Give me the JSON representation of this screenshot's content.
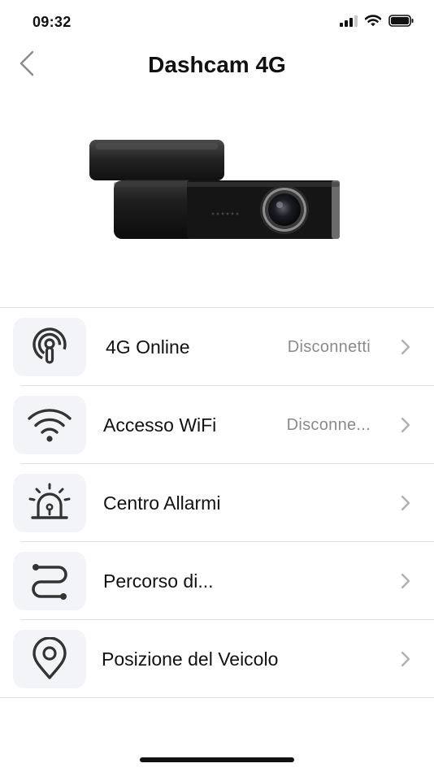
{
  "status_bar": {
    "time": "09:32",
    "icons": [
      "signal-icon",
      "wifi-icon",
      "battery-icon"
    ]
  },
  "nav": {
    "title": "Dashcam 4G",
    "back_icon": "chevron-left-icon"
  },
  "device": {
    "image": "dashcam-device-image"
  },
  "menu": {
    "items": [
      {
        "label": "4G Online",
        "status": "Disconnetti",
        "icon": "online-signal-icon"
      },
      {
        "label": "Accesso WiFi",
        "status": "Disconne...",
        "icon": "wifi-icon"
      },
      {
        "label": "Centro Allarmi",
        "status": "",
        "icon": "alarm-siren-icon"
      },
      {
        "label": "Percorso di...",
        "status": "",
        "icon": "route-icon"
      },
      {
        "label": "Posizione del Veicolo",
        "status": "",
        "icon": "location-pin-icon"
      }
    ]
  },
  "colors": {
    "background": "#ffffff",
    "icon_tile": "#f3f4f8",
    "icon_stroke": "#333333",
    "status_text": "#8a8a8a",
    "divider": "#e2e2e2",
    "chevron": "#b0b0b0"
  }
}
